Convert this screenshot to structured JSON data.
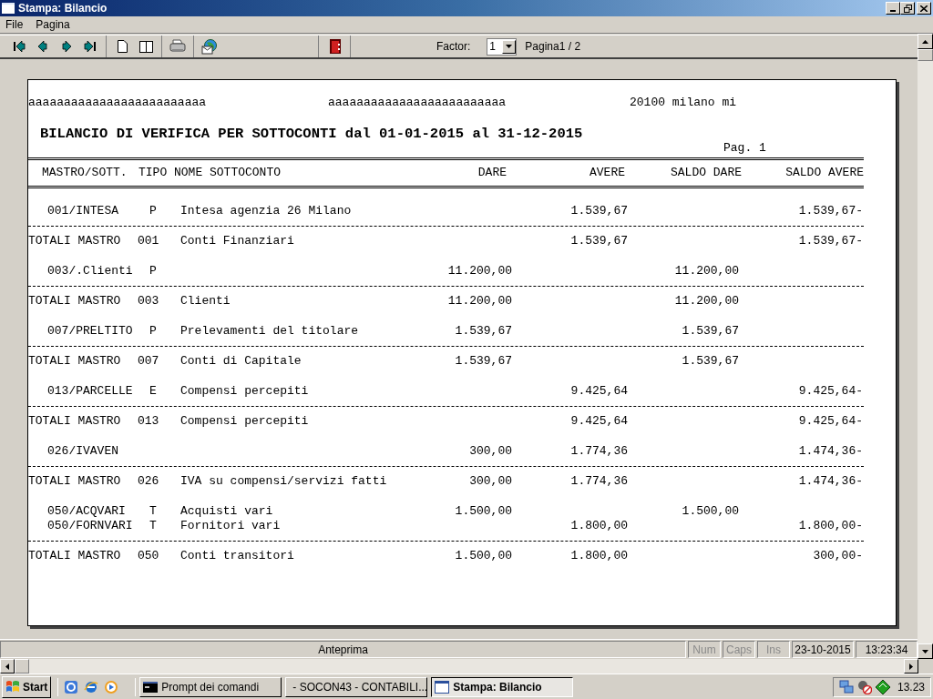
{
  "window": {
    "title": "Stampa: Bilancio"
  },
  "menu": [
    "File",
    "Pagina"
  ],
  "toolbar": {
    "factor_label": "Factor:",
    "factor_value": "1",
    "page_info": "Pagina1 / 2"
  },
  "report": {
    "header": [
      "aaaaaaaaaaaaaaaaaaaaaaaaa",
      "aaaaaaaaaaaaaaaaaaaaaaaaa",
      "20100 milano mi"
    ],
    "title": "BILANCIO DI VERIFICA PER SOTTOCONTI dal 01-01-2015 al 31-12-2015",
    "page": "Pag. 1",
    "columns": [
      "MASTRO/SOTT.",
      "TIPO",
      "NOME SOTTOCONTO",
      "DARE",
      "AVERE",
      "SALDO DARE",
      "SALDO AVERE"
    ],
    "groups": [
      {
        "accounts": [
          {
            "code": "001/INTESA",
            "tipo": "P",
            "name": "Intesa agenzia 26 Milano",
            "avere": "1.539,67",
            "saldo_avere": "1.539,67-"
          }
        ],
        "total": {
          "label": "TOTALI MASTRO",
          "code": "001",
          "name": "Conti Finanziari",
          "avere": "1.539,67",
          "saldo_avere": "1.539,67-"
        }
      },
      {
        "accounts": [
          {
            "code": "003/.Clienti",
            "tipo": "P",
            "dare": "11.200,00",
            "saldo_dare": "11.200,00"
          }
        ],
        "total": {
          "label": "TOTALI MASTRO",
          "code": "003",
          "name": "Clienti",
          "dare": "11.200,00",
          "saldo_dare": "11.200,00"
        }
      },
      {
        "accounts": [
          {
            "code": "007/PRELTITO",
            "tipo": "P",
            "name": "Prelevamenti del titolare",
            "dare": "1.539,67",
            "saldo_dare": "1.539,67"
          }
        ],
        "total": {
          "label": "TOTALI MASTRO",
          "code": "007",
          "name": "Conti di Capitale",
          "dare": "1.539,67",
          "saldo_dare": "1.539,67"
        }
      },
      {
        "accounts": [
          {
            "code": "013/PARCELLE",
            "tipo": "E",
            "name": "Compensi percepiti",
            "avere": "9.425,64",
            "saldo_avere": "9.425,64-"
          }
        ],
        "total": {
          "label": "TOTALI MASTRO",
          "code": "013",
          "name": "Compensi percepiti",
          "avere": "9.425,64",
          "saldo_avere": "9.425,64-"
        }
      },
      {
        "accounts": [
          {
            "code": "026/IVAVEN",
            "dare": "300,00",
            "avere": "1.774,36",
            "saldo_avere": "1.474,36-"
          }
        ],
        "total": {
          "label": "TOTALI MASTRO",
          "code": "026",
          "name": "IVA su compensi/servizi fatti",
          "dare": "300,00",
          "avere": "1.774,36",
          "saldo_avere": "1.474,36-"
        }
      },
      {
        "accounts": [
          {
            "code": "050/ACQVARI",
            "tipo": "T",
            "name": "Acquisti vari",
            "dare": "1.500,00",
            "saldo_dare": "1.500,00"
          },
          {
            "code": "050/FORNVARI",
            "tipo": "T",
            "name": "Fornitori vari",
            "avere": "1.800,00",
            "saldo_avere": "1.800,00-"
          }
        ],
        "total": {
          "label": "TOTALI MASTRO",
          "code": "050",
          "name": "Conti transitori",
          "dare": "1.500,00",
          "avere": "1.800,00",
          "saldo_avere": "300,00-"
        }
      }
    ]
  },
  "status_bar": {
    "message": "Anteprima",
    "indicators": [
      {
        "label": "Num",
        "active": false
      },
      {
        "label": "Caps",
        "active": false
      },
      {
        "label": "Ins",
        "active": false
      }
    ],
    "date": "23-10-2015",
    "time": "13:23:34"
  },
  "taskbar": {
    "start": "Start",
    "tasks": [
      {
        "label": "Prompt dei comandi",
        "kind": "console",
        "selected": false
      },
      {
        "label": "- SOCON43 - CONTABILI...",
        "kind": "window",
        "selected": false
      },
      {
        "label": "Stampa: Bilancio",
        "kind": "window",
        "selected": true
      }
    ],
    "clock": "13.23"
  }
}
